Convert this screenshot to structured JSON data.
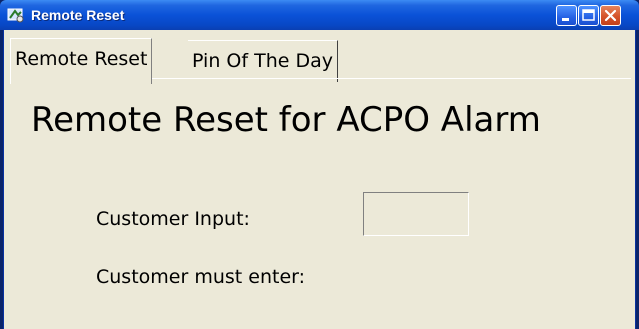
{
  "window": {
    "title": "Remote Reset",
    "icon": "app-icon",
    "controls": [
      "minimize-icon",
      "maximize-icon",
      "close-icon"
    ]
  },
  "tabs": [
    {
      "label": "Remote Reset",
      "active": true
    },
    {
      "label": "Pin Of The Day",
      "active": false
    }
  ],
  "main": {
    "heading": "Remote Reset for ACPO Alarm",
    "customer_input_label": "Customer Input:",
    "customer_input_value": "",
    "customer_must_enter_label": "Customer must enter:"
  },
  "colors": {
    "titlebar": "#0a52d8",
    "client_background": "#ece9d8"
  }
}
